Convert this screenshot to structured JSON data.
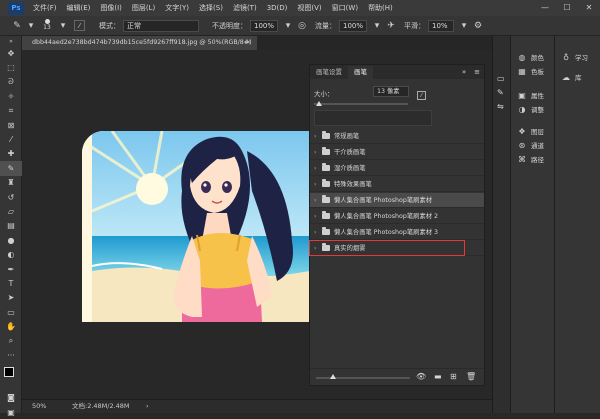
{
  "app": {
    "logo": "Ps",
    "menu": [
      "文件(F)",
      "编辑(E)",
      "图像(I)",
      "图层(L)",
      "文字(Y)",
      "选择(S)",
      "滤镜(T)",
      "3D(D)",
      "视图(V)",
      "窗口(W)",
      "帮助(H)"
    ]
  },
  "options": {
    "brush_size": "13",
    "mode_label": "模式：",
    "mode_value": "正常",
    "opacity_label": "不透明度：",
    "opacity_value": "100%",
    "flow_label": "流量：",
    "flow_value": "100%",
    "smooth_label": "平滑：",
    "smooth_value": "10%"
  },
  "document": {
    "tab_title": "dbb44aed2e738bd474b739db15ce5fd9267ff918.jpg @ 50%(RGB/8#)",
    "close": "×"
  },
  "status": {
    "zoom": "50%",
    "doc_info": "文档:2.48M/2.48M"
  },
  "brush_panel": {
    "tabs": [
      "画笔设置",
      "画笔"
    ],
    "size_label": "大小：",
    "size_value": "13 像素",
    "folders": [
      "常规画笔",
      "干介质画笔",
      "湿介质画笔",
      "特殊效果画笔",
      "懒人集合画笔 Photoshop笔刷素材",
      "懒人集合画笔 Photoshop笔刷素材 2",
      "懒人集合画笔 Photoshop笔刷素材 3",
      "真实的烟雾"
    ]
  },
  "right_panels": {
    "group1": [
      "颜色",
      "色板"
    ],
    "group2": [
      "属性",
      "调整"
    ],
    "group3": [
      "图层",
      "通道",
      "路径"
    ],
    "group4": [
      "学习",
      "库"
    ]
  }
}
